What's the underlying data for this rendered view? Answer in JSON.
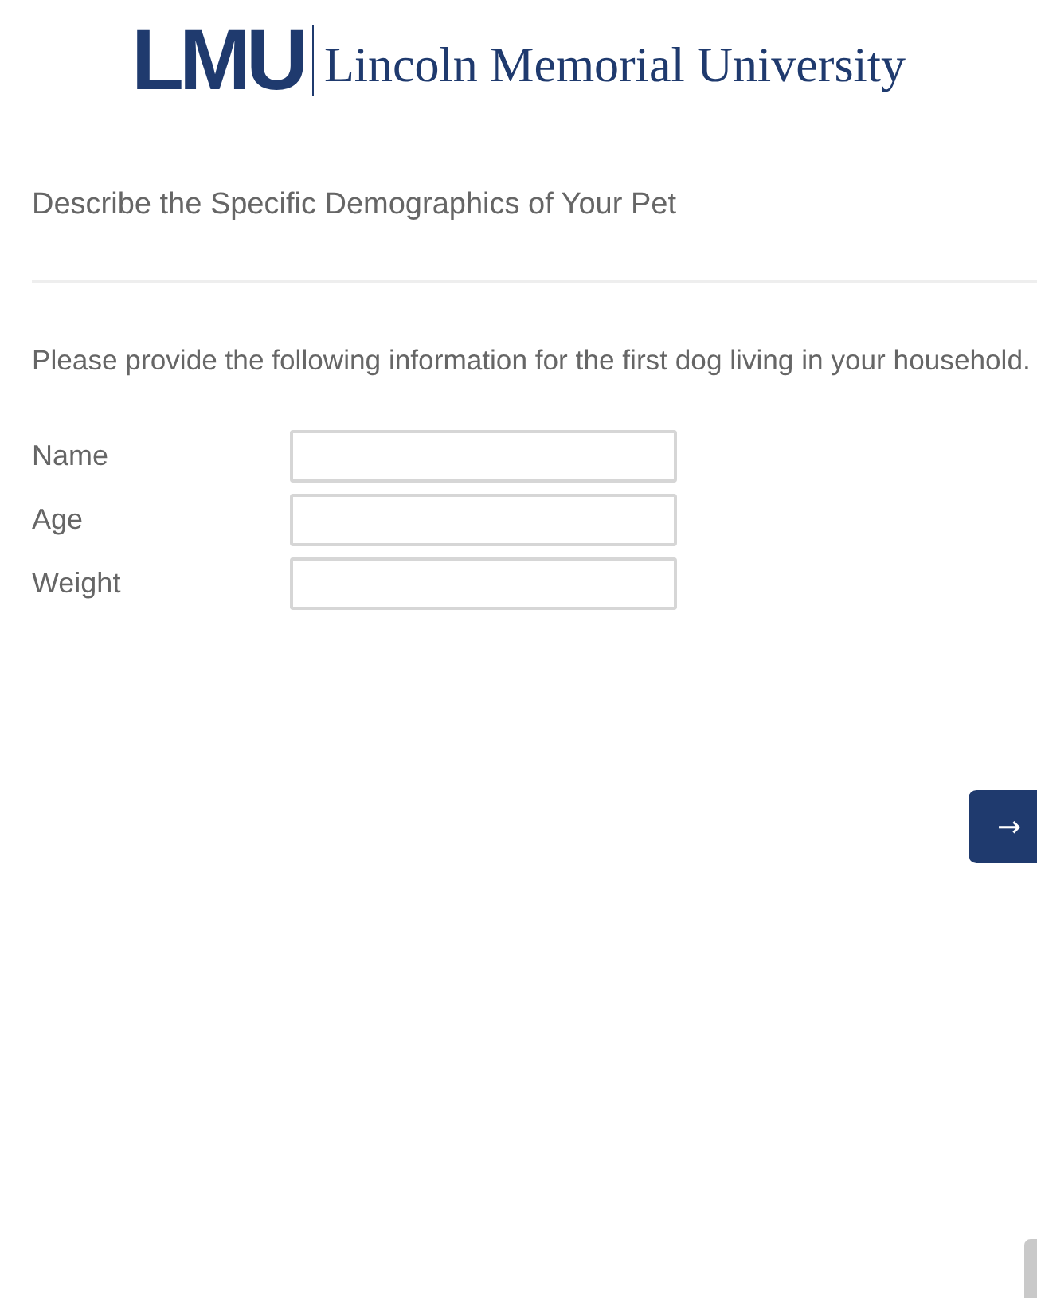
{
  "logo": {
    "mark": "LMU",
    "name": "Lincoln Memorial University"
  },
  "section_title": "Describe the Specific Demographics of Your Pet",
  "question": "Please provide the following information for the first dog living in your household.",
  "fields": [
    {
      "label": "Name"
    },
    {
      "label": "Age"
    },
    {
      "label": "Weight"
    }
  ],
  "next_button": {
    "label": "→"
  }
}
